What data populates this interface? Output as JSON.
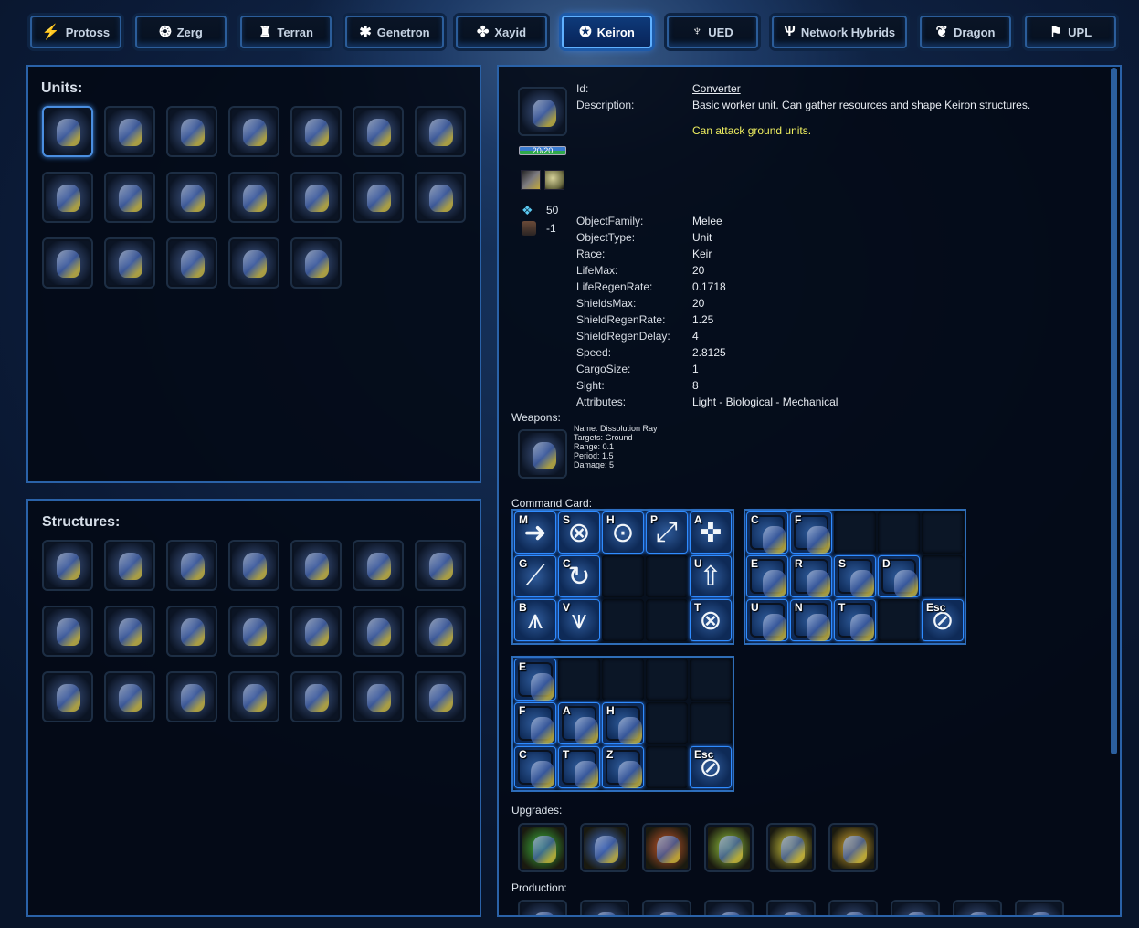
{
  "tabs": [
    {
      "label": "Protoss",
      "icon": "protoss-icon",
      "glyph": "⚡"
    },
    {
      "label": "Zerg",
      "icon": "zerg-icon",
      "glyph": "❂"
    },
    {
      "label": "Terran",
      "icon": "terran-icon",
      "glyph": "♜"
    },
    {
      "label": "Genetron",
      "icon": "genetron-icon",
      "glyph": "✱"
    },
    {
      "label": "Xayid",
      "icon": "xayid-icon",
      "glyph": "✤"
    },
    {
      "label": "Keiron",
      "icon": "keiron-icon",
      "glyph": "✪",
      "active": true
    },
    {
      "label": "UED",
      "icon": "ued-icon",
      "glyph": "♆"
    },
    {
      "label": "Network Hybrids",
      "icon": "network-hybrids-icon",
      "glyph": "Ѱ"
    },
    {
      "label": "Dragon",
      "icon": "dragon-icon",
      "glyph": "❦"
    },
    {
      "label": "UPL",
      "icon": "upl-icon",
      "glyph": "⚑"
    }
  ],
  "units": {
    "title": "Units:",
    "count": 19,
    "selected": 0
  },
  "structures": {
    "title": "Structures:",
    "count": 21
  },
  "detail": {
    "portrait": "converter-portrait",
    "life_bar": "20/20",
    "cost": {
      "minerals": "50",
      "supply": "-1"
    },
    "id_label": "Id:",
    "id_value": "Converter",
    "description_label": "Description:",
    "description": "Basic worker unit. Can gather resources and shape Keiron structures.",
    "attack_note": "Can attack ground units.",
    "attack_note_color": "#f0f060",
    "fields": [
      {
        "label": "ObjectFamily:",
        "value": "Melee"
      },
      {
        "label": "ObjectType:",
        "value": "Unit"
      },
      {
        "label": "Race:",
        "value": "Keir"
      },
      {
        "label": "LifeMax:",
        "value": "20"
      },
      {
        "label": "LifeRegenRate:",
        "value": "0.1718"
      },
      {
        "label": "ShieldsMax:",
        "value": "20"
      },
      {
        "label": "ShieldRegenRate:",
        "value": "1.25"
      },
      {
        "label": "ShieldRegenDelay:",
        "value": "4"
      },
      {
        "label": "Speed:",
        "value": "2.8125"
      },
      {
        "label": "CargoSize:",
        "value": "1"
      },
      {
        "label": "Sight:",
        "value": "8"
      },
      {
        "label": "Attributes:",
        "value": "Light - Biological - Mechanical"
      }
    ],
    "weapons_label": "Weapons:",
    "weapon": {
      "name": "Name: Dissolution Ray",
      "targets": "Targets: Ground",
      "range": "Range: 0.1",
      "period": "Period: 1.5",
      "damage": "Damage: 5"
    },
    "command_card_label": "Command Card:",
    "upgrades_label": "Upgrades:",
    "upgrades_count": 6,
    "production_label": "Production:",
    "production_count": 9
  },
  "command_cards": [
    [
      [
        "M",
        "➜"
      ],
      [
        "S",
        "⊗"
      ],
      [
        "H",
        "⊙"
      ],
      [
        "P",
        "⤢"
      ],
      [
        "A",
        "✜"
      ],
      [
        "G",
        "⟋"
      ],
      [
        "C",
        "↻"
      ],
      null,
      null,
      [
        "U",
        "⇧"
      ],
      [
        "B",
        "⩚"
      ],
      [
        "V",
        "⩛"
      ],
      null,
      null,
      [
        "T",
        "⊗"
      ]
    ],
    [
      [
        "C",
        ""
      ],
      [
        "F",
        ""
      ],
      null,
      null,
      null,
      [
        "E",
        ""
      ],
      [
        "R",
        ""
      ],
      [
        "S",
        ""
      ],
      [
        "D",
        ""
      ],
      null,
      [
        "U",
        ""
      ],
      [
        "N",
        ""
      ],
      [
        "T",
        ""
      ],
      null,
      [
        "Esc",
        "⊘"
      ]
    ],
    [
      [
        "E",
        ""
      ],
      null,
      null,
      null,
      null,
      [
        "F",
        ""
      ],
      [
        "A",
        ""
      ],
      [
        "H",
        ""
      ],
      null,
      null,
      [
        "C",
        ""
      ],
      [
        "T",
        ""
      ],
      [
        "Z",
        ""
      ],
      null,
      [
        "Esc",
        "⊘"
      ]
    ]
  ]
}
